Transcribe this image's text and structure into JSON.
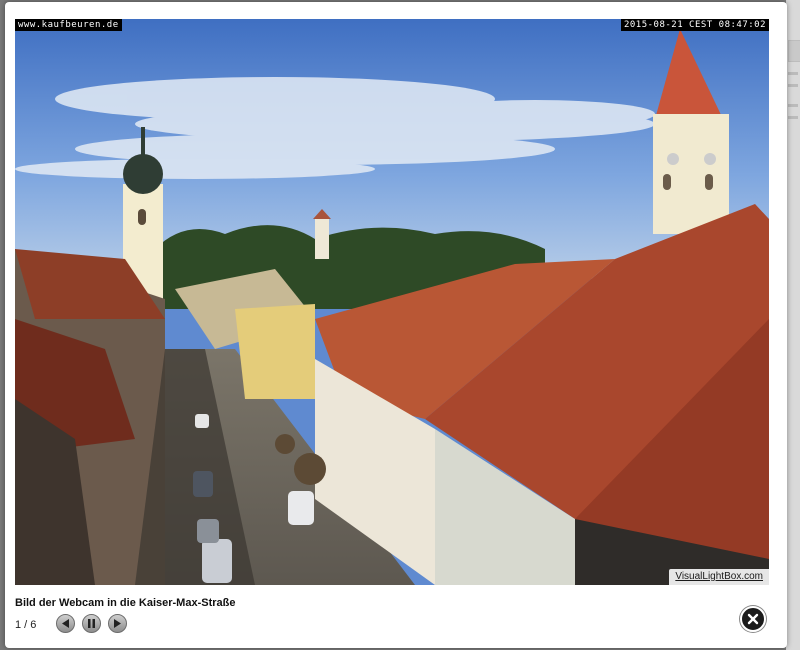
{
  "webcam": {
    "url_overlay": "www.kaufbeuren.de",
    "timestamp_overlay": "2015-08-21 CEST 08:47:02"
  },
  "lightbox": {
    "caption": "Bild der Webcam in die Kaiser-Max-Straße",
    "counter": "1 / 6",
    "credit": "VisualLightBox.com",
    "controls": {
      "prev_icon": "prev-icon",
      "pause_icon": "pause-icon",
      "next_icon": "next-icon",
      "close_icon": "close-icon"
    }
  },
  "colors": {
    "sky": "#5f8ad0",
    "roof": "#b5532f",
    "overlay_bg": "#000000",
    "panel_bg": "#ffffff"
  }
}
